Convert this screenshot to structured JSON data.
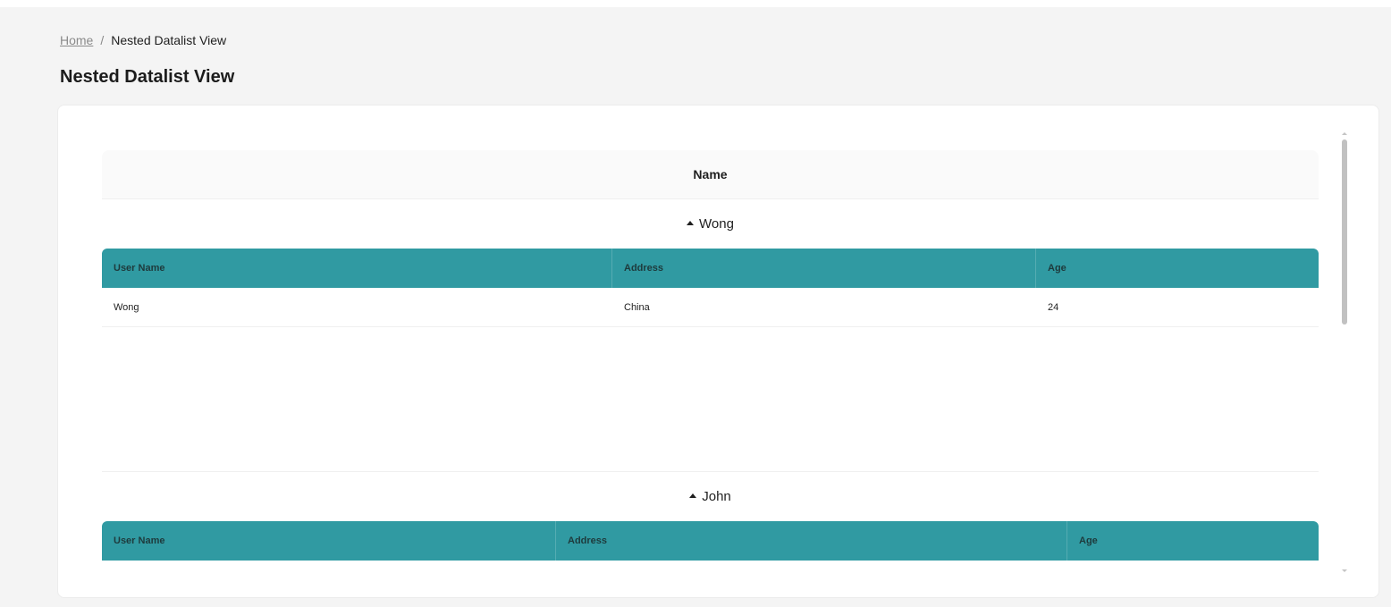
{
  "breadcrumb": {
    "home": "Home",
    "separator": "/",
    "current": "Nested Datalist View"
  },
  "page_title": "Nested Datalist View",
  "outer_table": {
    "header": "Name",
    "groups": [
      {
        "name": "Wong",
        "expanded": true,
        "columns": [
          "User Name",
          "Address",
          "Age"
        ],
        "rows": [
          [
            "Wong",
            "China",
            "24"
          ]
        ]
      },
      {
        "name": "John",
        "expanded": true,
        "columns": [
          "User Name",
          "Address",
          "Age"
        ],
        "rows": []
      }
    ]
  },
  "colors": {
    "accent": "#309aa2",
    "page_bg": "#f4f4f4",
    "card_bg": "#ffffff"
  },
  "icons": {
    "expand": "caret-up-icon"
  }
}
